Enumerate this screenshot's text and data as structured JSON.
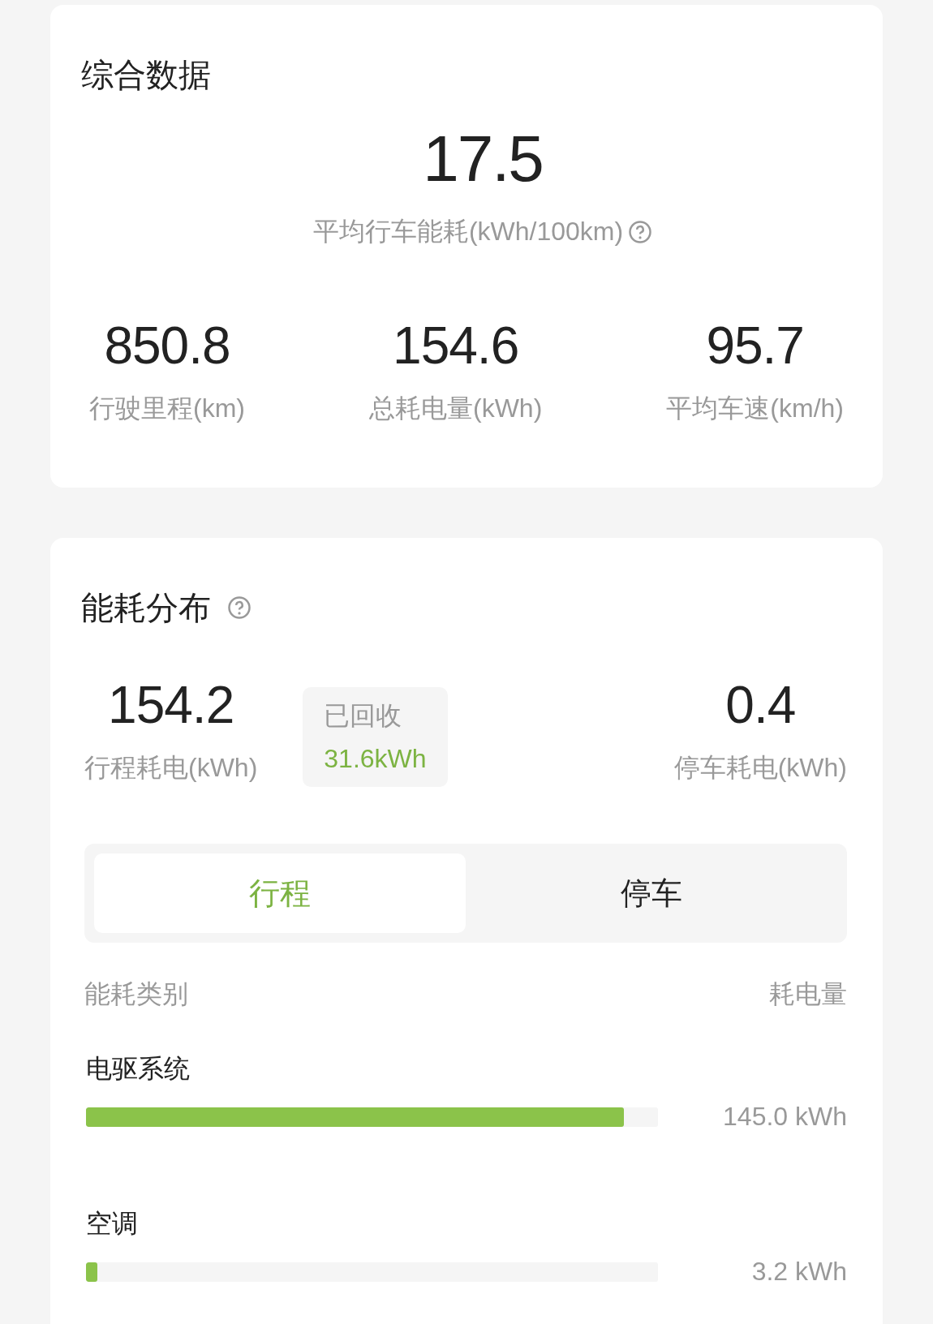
{
  "summary": {
    "title": "综合数据",
    "main_value": "17.5",
    "main_label": "平均行车能耗(kWh/100km)",
    "stats": [
      {
        "value": "850.8",
        "label": "行驶里程(km)"
      },
      {
        "value": "154.6",
        "label": "总耗电量(kWh)"
      },
      {
        "value": "95.7",
        "label": "平均车速(km/h)"
      }
    ]
  },
  "distribution": {
    "title": "能耗分布",
    "trip": {
      "value": "154.2",
      "label": "行程耗电(kWh)"
    },
    "recovered": {
      "label": "已回收",
      "value": "31.6kWh"
    },
    "parking": {
      "value": "0.4",
      "label": "停车耗电(kWh)"
    },
    "tabs": [
      {
        "label": "行程",
        "selected": true
      },
      {
        "label": "停车",
        "selected": false
      }
    ],
    "columns": [
      "能耗类别",
      "耗电量"
    ],
    "items": [
      {
        "name": "电驱系统",
        "level": 0.94,
        "reading": "145.0 kWh"
      },
      {
        "name": "空调",
        "level": 0.02,
        "reading": "3.2 kWh"
      }
    ]
  }
}
